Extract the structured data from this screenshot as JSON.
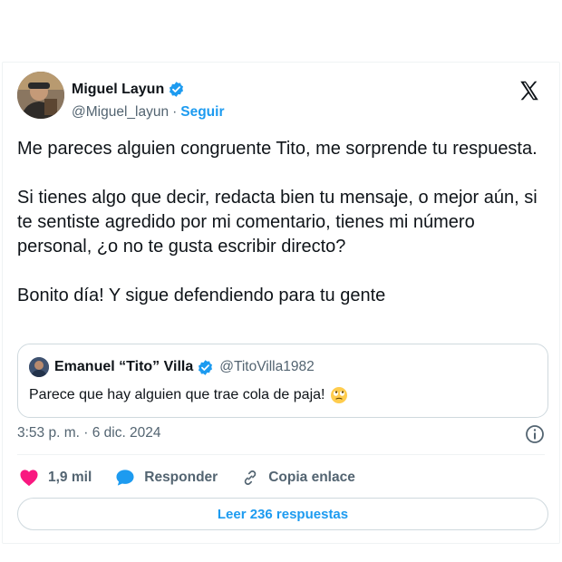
{
  "tweet": {
    "author_name": "Miguel Layun",
    "author_handle": "@Miguel_layun",
    "separator": "·",
    "follow_label": "Seguir",
    "paragraphs": [
      "Me pareces alguien congruente Tito, me sorprende tu respuesta.",
      "Si tienes algo que decir, redacta bien tu mensaje, o mejor aún, si te sentiste agredido por mi comentario, tienes mi número personal, ¿o no te gusta escribir directo?",
      "Bonito día! Y sigue defendiendo para tu gente"
    ],
    "timestamp": "3:53 p. m. · 6 dic. 2024"
  },
  "quoted_tweet": {
    "author_name": "Emanuel “Tito” Villa",
    "author_handle": "@TitoVilla1982",
    "text": "Parece que hay alguien que trae cola de paja!"
  },
  "actions": {
    "likes_count": "1,9 mil",
    "reply_label": "Responder",
    "copy_link_label": "Copia enlace"
  },
  "read_replies_label": "Leer 236 respuestas",
  "colors": {
    "accent": "#1d9bf0",
    "like": "#f91880",
    "text_primary": "#0f1419",
    "text_secondary": "#536471"
  },
  "icons": [
    "verified-badge-icon",
    "x-logo-icon",
    "info-icon",
    "heart-icon",
    "reply-bubble-icon",
    "link-icon",
    "rolling-eyes-emoji"
  ]
}
